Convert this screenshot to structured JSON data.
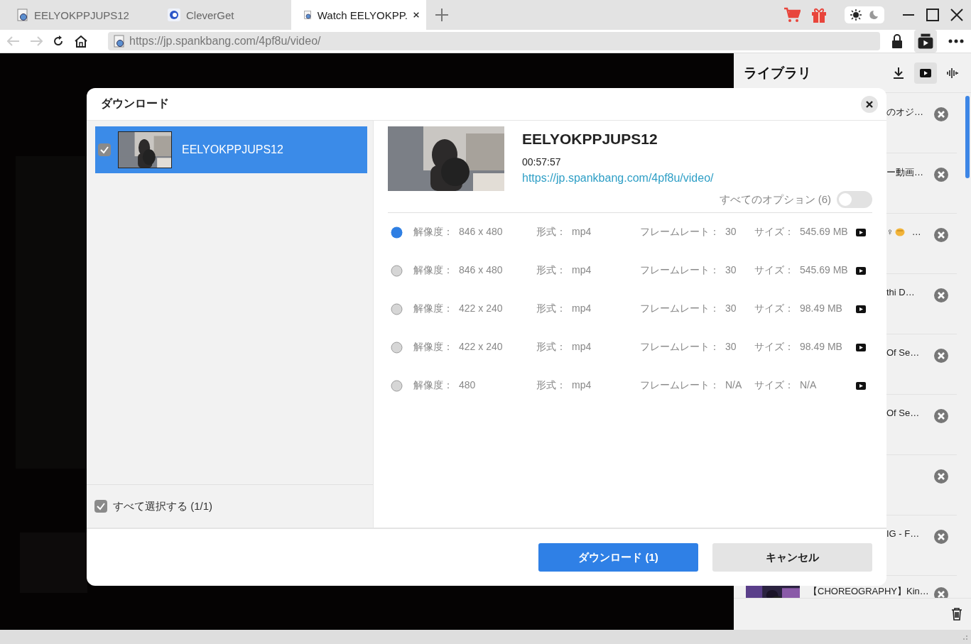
{
  "browser_tabs": [
    {
      "label": "EELYOKPPJUPS12",
      "kind": "page",
      "selected": false
    },
    {
      "label": "CleverGet",
      "kind": "app",
      "selected": false
    },
    {
      "label": "Watch EELYOKPP.",
      "kind": "page",
      "selected": true
    }
  ],
  "theme_modes": [
    {
      "kind": "light",
      "selected": true
    },
    {
      "kind": "dark",
      "selected": false
    }
  ],
  "toolbar": {
    "back_disabled": true,
    "forward_disabled": true,
    "url": "https://jp.spankbang.com/4pf8u/video/"
  },
  "dialog": {
    "title": "ダウンロード",
    "videos": [
      {
        "title": "EELYOKPPJUPS12",
        "checked": true,
        "selected": true
      }
    ],
    "select_all": {
      "label": "すべて選択する (1/1)",
      "checked": true
    },
    "detail": {
      "title": "EELYOKPPJUPS12",
      "duration": "00:57:57",
      "url": "https://jp.spankbang.com/4pf8u/video/"
    },
    "all_options": {
      "label": "すべてのオプション (6)",
      "on": false
    },
    "options": [
      {
        "resolution_label": "解像度：",
        "resolution": "846 x 480",
        "format_label": "形式：",
        "format": "mp4",
        "framerate_label": "フレームレート：",
        "framerate": "30",
        "size_label": "サイズ：",
        "size": "545.69 MB",
        "selected": true
      },
      {
        "resolution_label": "解像度：",
        "resolution": "846 x 480",
        "format_label": "形式：",
        "format": "mp4",
        "framerate_label": "フレームレート：",
        "framerate": "30",
        "size_label": "サイズ：",
        "size": "545.69 MB",
        "selected": false
      },
      {
        "resolution_label": "解像度：",
        "resolution": "422 x 240",
        "format_label": "形式：",
        "format": "mp4",
        "framerate_label": "フレームレート：",
        "framerate": "30",
        "size_label": "サイズ：",
        "size": "98.49 MB",
        "selected": false
      },
      {
        "resolution_label": "解像度：",
        "resolution": "422 x 240",
        "format_label": "形式：",
        "format": "mp4",
        "framerate_label": "フレームレート：",
        "framerate": "30",
        "size_label": "サイズ：",
        "size": "98.49 MB",
        "selected": false
      },
      {
        "resolution_label": "解像度：",
        "resolution": "480",
        "format_label": "形式：",
        "format": "mp4",
        "framerate_label": "フレームレート：",
        "framerate": "N/A",
        "size_label": "サイズ：",
        "size": "N/A",
        "selected": false
      }
    ],
    "buttons": [
      {
        "label": "ダウンロード (1)",
        "kind": "primary"
      },
      {
        "label": "キャンセル",
        "kind": "secondary"
      }
    ]
  },
  "library": {
    "title": "ライブラリ",
    "modes": [
      {
        "kind": "download",
        "selected": false
      },
      {
        "kind": "video",
        "selected": true
      },
      {
        "kind": "audio",
        "selected": false
      }
    ],
    "items": [
      {
        "kind": "text",
        "title": "のオジ…"
      },
      {
        "kind": "text",
        "title": "ー動画…"
      },
      {
        "kind": "emoji",
        "title": "♀",
        "suffix": "…"
      },
      {
        "kind": "text",
        "title": "thi D…"
      },
      {
        "kind": "text",
        "title": "Of Se…"
      },
      {
        "kind": "text",
        "title": "Of Se…"
      },
      {
        "kind": "blank"
      },
      {
        "kind": "text",
        "title": "IG - F…"
      },
      {
        "kind": "thumb",
        "title": "【CHOREOGRAPHY】Kin…"
      }
    ]
  }
}
